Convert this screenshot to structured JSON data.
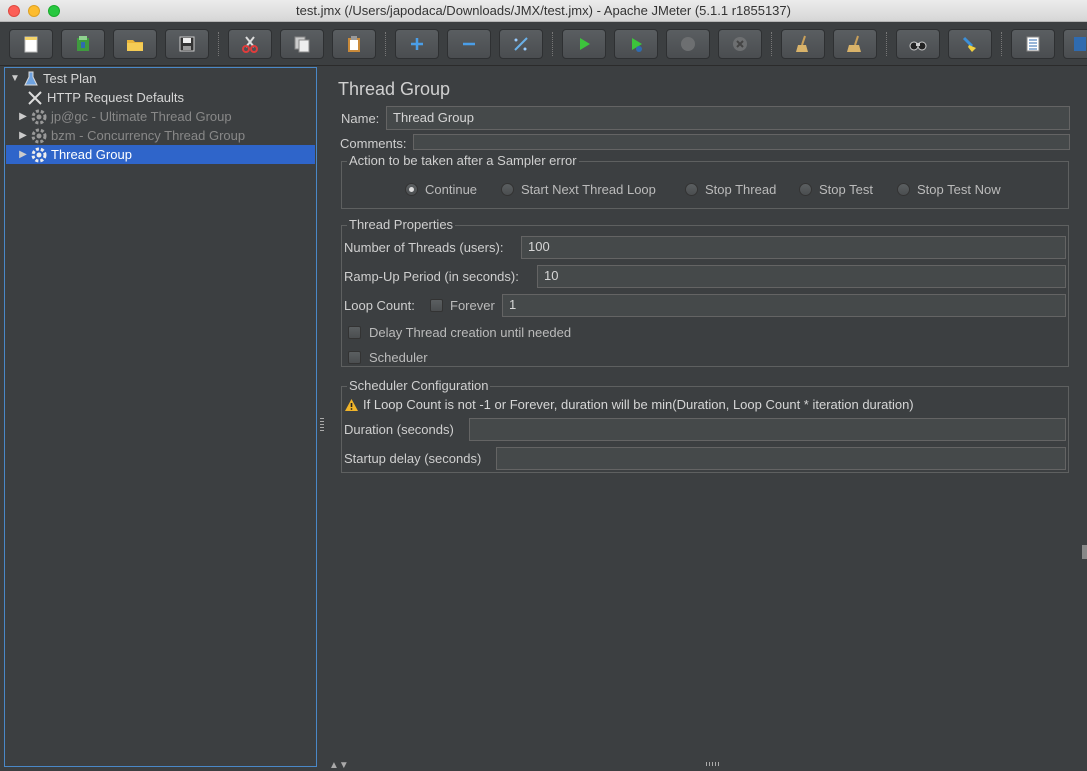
{
  "window": {
    "title": "test.jmx (/Users/japodaca/Downloads/JMX/test.jmx) - Apache JMeter (5.1.1 r1855137)"
  },
  "toolbar": {
    "buttons": [
      "new",
      "templates",
      "open",
      "save",
      "cut",
      "copy",
      "paste",
      "expand",
      "collapse",
      "toggle",
      "start",
      "start-no-pauses",
      "stop",
      "shutdown",
      "clear",
      "clear-all",
      "search",
      "reset-search",
      "function-helper",
      "more"
    ]
  },
  "tree": {
    "items": [
      {
        "label": "Test Plan",
        "icon": "test-plan-icon",
        "expanded": true
      },
      {
        "label": "HTTP Request Defaults",
        "icon": "config-wrench-icon"
      },
      {
        "label": "jp@gc - Ultimate Thread Group",
        "icon": "gear-icon",
        "disabled": true
      },
      {
        "label": "bzm - Concurrency Thread Group",
        "icon": "gear-icon",
        "disabled": true
      },
      {
        "label": "Thread Group",
        "icon": "gear-icon",
        "selected": true
      }
    ]
  },
  "panel": {
    "title": "Thread Group",
    "name_label": "Name:",
    "name_value": "Thread Group",
    "comments_label": "Comments:",
    "comments_value": "",
    "sampler_error": {
      "legend": "Action to be taken after a Sampler error",
      "options": [
        "Continue",
        "Start Next Thread Loop",
        "Stop Thread",
        "Stop Test",
        "Stop Test Now"
      ],
      "selected": "Continue"
    },
    "thread_properties": {
      "legend": "Thread Properties",
      "threads_label": "Number of Threads (users):",
      "threads_value": "100",
      "rampup_label": "Ramp-Up Period (in seconds):",
      "rampup_value": "10",
      "loop_label": "Loop Count:",
      "forever_label": "Forever",
      "loop_value": "1",
      "delay_label": "Delay Thread creation until needed",
      "scheduler_label": "Scheduler"
    },
    "scheduler_config": {
      "legend": "Scheduler Configuration",
      "warning": "If Loop Count is not -1 or Forever, duration will be min(Duration, Loop Count * iteration duration)",
      "duration_label": "Duration (seconds)",
      "duration_value": "",
      "startup_label": "Startup delay (seconds)",
      "startup_value": ""
    }
  }
}
